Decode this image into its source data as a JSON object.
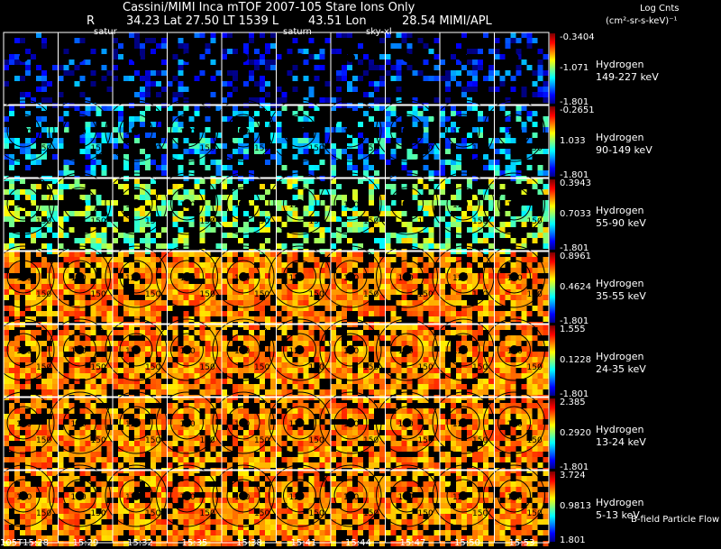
{
  "header": {
    "line1": "Cassini/MIMI Inca mTOF  2007-105   Stare    Ions Only",
    "line2_r": "R",
    "line2_values": "34.23 Lat 27.50 LT 1539 L",
    "line2_lon": "43.51 Lon",
    "line2_tail": "28.54   MIMI/APL",
    "saturn_labels": [
      "satur",
      "saturn",
      "sky-xl"
    ]
  },
  "units": {
    "title": "Log Cnts",
    "subtitle": "(cm²-sr-s-keV)⁻¹"
  },
  "rows": [
    {
      "species": "Hydrogen",
      "energy": "149-227 keV",
      "max": "-0.3404",
      "mid": "-1.071",
      "min": "-1.801",
      "hue": "cold"
    },
    {
      "species": "Hydrogen",
      "energy": "90-149 keV",
      "max": "-0.2651",
      "mid": "1.033",
      "min": "-1.801",
      "hue": "cool"
    },
    {
      "species": "Hydrogen",
      "energy": "55-90 keV",
      "max": "0.3943",
      "mid": "0.7033",
      "min": "-1.801",
      "hue": "mid"
    },
    {
      "species": "Hydrogen",
      "energy": "35-55 keV",
      "max": "0.8961",
      "mid": "0.4624",
      "min": "-1.801",
      "hue": "warm"
    },
    {
      "species": "Hydrogen",
      "energy": "24-35 keV",
      "max": "1.555",
      "mid": "0.1228",
      "min": "-1.801",
      "hue": "warm"
    },
    {
      "species": "Hydrogen",
      "energy": "13-24 keV",
      "max": "2.385",
      "mid": "0.2920",
      "min": "-1.801",
      "hue": "warm"
    },
    {
      "species": "Hydrogen",
      "energy": "5-13 keV",
      "max": "3.724",
      "mid": "0.9813",
      "min": "1.801",
      "hue": "warm"
    }
  ],
  "contour_labels": [
    "120",
    "150"
  ],
  "times": [
    "105T15:28",
    "15:29",
    "15:32",
    "15:35",
    "15:38",
    "15:41",
    "15:44",
    "15:47",
    "15:50",
    "15:53"
  ],
  "footer_note": "B-field Particle Flow",
  "colors": {
    "background": "#000000",
    "grid_line": "#ffffff",
    "contour": "#000000"
  }
}
